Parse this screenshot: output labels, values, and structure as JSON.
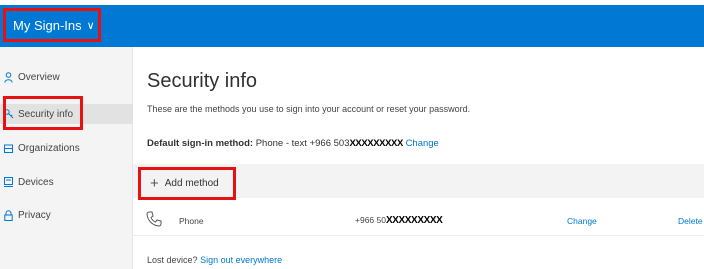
{
  "header": {
    "title": "My Sign-Ins",
    "chevron": "∨",
    "brand_color": "#0078d4",
    "highlight_color": "#e81010"
  },
  "sidebar": {
    "items": [
      {
        "label": "Overview",
        "icon": "person-icon"
      },
      {
        "label": "Security info",
        "icon": "key-icon",
        "active": true
      },
      {
        "label": "Organizations",
        "icon": "building-icon"
      },
      {
        "label": "Devices",
        "icon": "laptop-icon"
      },
      {
        "label": "Privacy",
        "icon": "lock-icon"
      }
    ]
  },
  "main": {
    "title": "Security info",
    "description": "These are the methods you use to sign into your account or reset your password.",
    "default_method_label": "Default sign-in method:",
    "default_method_value": "Phone - text +966 503",
    "default_method_masked": "XXXXXXXXX",
    "default_method_change": "Change",
    "add_method_label": "Add method",
    "methods": [
      {
        "icon": "phone-icon",
        "name": "Phone",
        "value_prefix": "+966 50",
        "value_masked": "XXXXXXXXX",
        "change": "Change",
        "delete": "Delete"
      }
    ],
    "lost_device_text": "Lost device?",
    "sign_out_link": "Sign out everywhere"
  }
}
